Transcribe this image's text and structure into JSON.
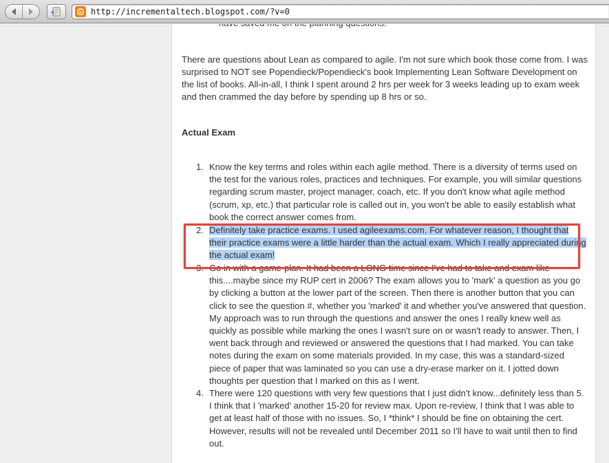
{
  "browser": {
    "url": "http://incrementaltech.blogspot.com/?v=0",
    "back_icon": "back-arrow-icon",
    "forward_icon": "forward-arrow-icon",
    "reader_icon": "reader-icon",
    "favicon": "blogger-favicon"
  },
  "post": {
    "cut_line": "have saved me on the planning questions.",
    "paragraph": "There are questions about Lean as compared to agile. I'm not sure which book those come from. I was surprised to NOT see Popendieck/Popendieck's book Implementing Lean Software Development on the list of books. All-in-all, I think I spent around 2 hrs per week for 3 weeks leading up to exam week and then crammed the day before by spending up 8 hrs or so.",
    "heading": "Actual Exam",
    "items": [
      {
        "num": "1.",
        "text": "Know the key terms and roles within each agile method. There is a diversity of terms used on the test for the various roles, practices and techniques. For example, you will similar questions regarding scrum master, project manager, coach, etc. If you don't know what agile method (scrum, xp, etc.) that particular role is called out in, you won't be able to easily establish what book the correct answer comes from."
      },
      {
        "num": "2.",
        "text": "Definitely take practice exams. I used agileexams.com. For whatever reason, I thought that their practice exams were a little harder than the actual exam. Which I really appreciated during the actual exam!"
      },
      {
        "num": "3.",
        "text": "Go in with a game-plan. It had been a LONG time since I've had to take and exam like this....maybe since my RUP cert in 2006? The exam allows you to 'mark' a question as you go by clicking a button at the lower part of the screen. Then there is another button that you can click to see the question #, whether you 'marked' it and whether you've answered that question. My approach was to run through the questions and answer the ones I really knew well as quickly as possible while marking the ones I wasn't sure on or wasn't ready to answer. Then, I went back through and reviewed or answered the questions that I had marked. You can take notes during the exam on some materials provided. In my case, this was a standard-sized piece of paper that was laminated so you can use a dry-erase marker on it. I jotted down thoughts per question that I marked on this as I went."
      },
      {
        "num": "4.",
        "text": "There were 120 questions with very few questions that I just didn't know...definitely less than 5. I think that I 'marked' another 15-20 for review max. Upon re-review, I think that I was able to get at least half of those with no issues. So, I *think* I should be fine on obtaining the cert. However, results will not be revealed until December 2011 so I'll have to wait until then to find out."
      }
    ]
  },
  "colors": {
    "selection": "#b3d3f7",
    "callout_border": "#e1453d",
    "blogger_orange": "#f57d00"
  }
}
